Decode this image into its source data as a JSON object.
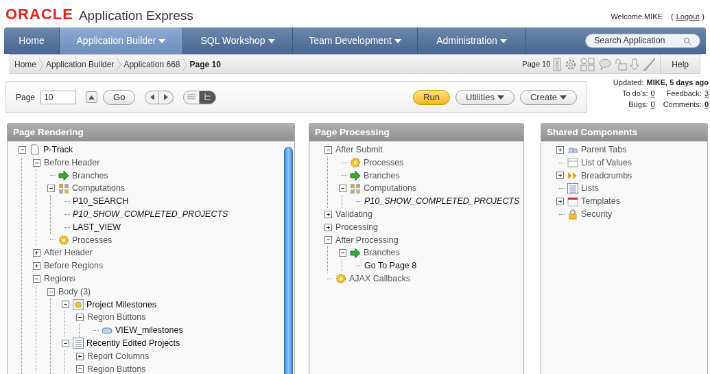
{
  "header": {
    "logo": "ORACLE",
    "product": "Application Express",
    "welcome": "Welcome MIKE",
    "logout_open": "(",
    "logout": "Logout",
    "logout_close": ")"
  },
  "nav": {
    "tabs": [
      {
        "label": "Home",
        "selected": false,
        "menu": false
      },
      {
        "label": "Application Builder",
        "selected": true,
        "menu": true
      },
      {
        "label": "SQL Workshop",
        "selected": false,
        "menu": true
      },
      {
        "label": "Team Development",
        "selected": false,
        "menu": true
      },
      {
        "label": "Administration",
        "selected": false,
        "menu": true
      }
    ],
    "search": {
      "placeholder": "Search Application"
    }
  },
  "breadcrumb": {
    "items": [
      {
        "label": "Home",
        "current": false
      },
      {
        "label": "Application Builder",
        "current": false
      },
      {
        "label": "Application 668",
        "current": false
      },
      {
        "label": "Page 10",
        "current": true
      }
    ],
    "page_label": "Page 10",
    "help": "Help"
  },
  "toolbar": {
    "page_label": "Page",
    "page_value": "10",
    "go": "Go",
    "views": [
      {
        "selected": false
      },
      {
        "selected": true
      }
    ],
    "run": "Run",
    "utilities": "Utilities",
    "create": "Create"
  },
  "info": {
    "updated_label": "Updated:",
    "updated_value": "MIKE, 5 days ago",
    "stats": [
      {
        "label": "To do's:",
        "value": "0",
        "highlight": false
      },
      {
        "label": "Feedback:",
        "value": "3",
        "highlight": false
      },
      {
        "label": "Bugs:",
        "value": "0",
        "highlight": false
      },
      {
        "label": "Comments:",
        "value": "0",
        "highlight": true
      }
    ]
  },
  "panels": [
    {
      "title": "Page Rendering",
      "tree": [
        {
          "label": "P-Track",
          "kind": "page",
          "expanded": true,
          "children": [
            {
              "label": "Before Header",
              "kind": "section",
              "expanded": true,
              "children": [
                {
                  "label": "Branches",
                  "kind": "branch"
                },
                {
                  "label": "Computations",
                  "kind": "computation",
                  "expanded": true,
                  "children": [
                    {
                      "label": "P10_SEARCH",
                      "kind": "item"
                    },
                    {
                      "label": "P10_SHOW_COMPLETED_PROJECTS",
                      "kind": "conditional-item"
                    },
                    {
                      "label": "LAST_VIEW",
                      "kind": "item"
                    }
                  ]
                },
                {
                  "label": "Processes",
                  "kind": "process"
                }
              ]
            },
            {
              "label": "After Header",
              "kind": "section",
              "expanded": false
            },
            {
              "label": "Before Regions",
              "kind": "section",
              "expanded": false
            },
            {
              "label": "Regions",
              "kind": "section",
              "expanded": true,
              "children": [
                {
                  "label": "Body (3)",
                  "kind": "section",
                  "expanded": true,
                  "children": [
                    {
                      "label": "Project Milestones",
                      "kind": "region",
                      "expanded": true,
                      "children": [
                        {
                          "label": "Region Buttons",
                          "kind": "section",
                          "expanded": true,
                          "children": [
                            {
                              "label": "VIEW_milestones",
                              "kind": "button"
                            }
                          ]
                        }
                      ]
                    },
                    {
                      "label": "Recently Edited Projects",
                      "kind": "report",
                      "expanded": true,
                      "children": [
                        {
                          "label": "Report Columns",
                          "kind": "section",
                          "expanded": false
                        },
                        {
                          "label": "Region Buttons",
                          "kind": "section",
                          "expanded": true
                        }
                      ]
                    }
                  ]
                }
              ]
            }
          ]
        }
      ]
    },
    {
      "title": "Page Processing",
      "tree": [
        {
          "label": "After Submit",
          "kind": "section",
          "expanded": true,
          "children": [
            {
              "label": "Processes",
              "kind": "process"
            },
            {
              "label": "Branches",
              "kind": "branch"
            },
            {
              "label": "Computations",
              "kind": "computation",
              "expanded": true,
              "children": [
                {
                  "label": "P10_SHOW_COMPLETED_PROJECTS",
                  "kind": "conditional-item"
                }
              ]
            }
          ]
        },
        {
          "label": "Validating",
          "kind": "section",
          "expanded": false
        },
        {
          "label": "Processing",
          "kind": "section",
          "expanded": false
        },
        {
          "label": "After Processing",
          "kind": "section",
          "expanded": true,
          "children": [
            {
              "label": "Branches",
              "kind": "branch",
              "expanded": true,
              "children": [
                {
                  "label": "Go To Page 8",
                  "kind": "item"
                }
              ]
            }
          ]
        },
        {
          "label": "AJAX Callbacks",
          "kind": "process"
        }
      ]
    },
    {
      "title": "Shared Components",
      "tree": [
        {
          "label": "Parent Tabs",
          "kind": "tabs",
          "expanded": false
        },
        {
          "label": "List of Values",
          "kind": "lov"
        },
        {
          "label": "Breadcrumbs",
          "kind": "breadcrumb",
          "expanded": false
        },
        {
          "label": "Lists",
          "kind": "list"
        },
        {
          "label": "Templates",
          "kind": "template",
          "expanded": false
        },
        {
          "label": "Security",
          "kind": "security"
        }
      ]
    }
  ]
}
